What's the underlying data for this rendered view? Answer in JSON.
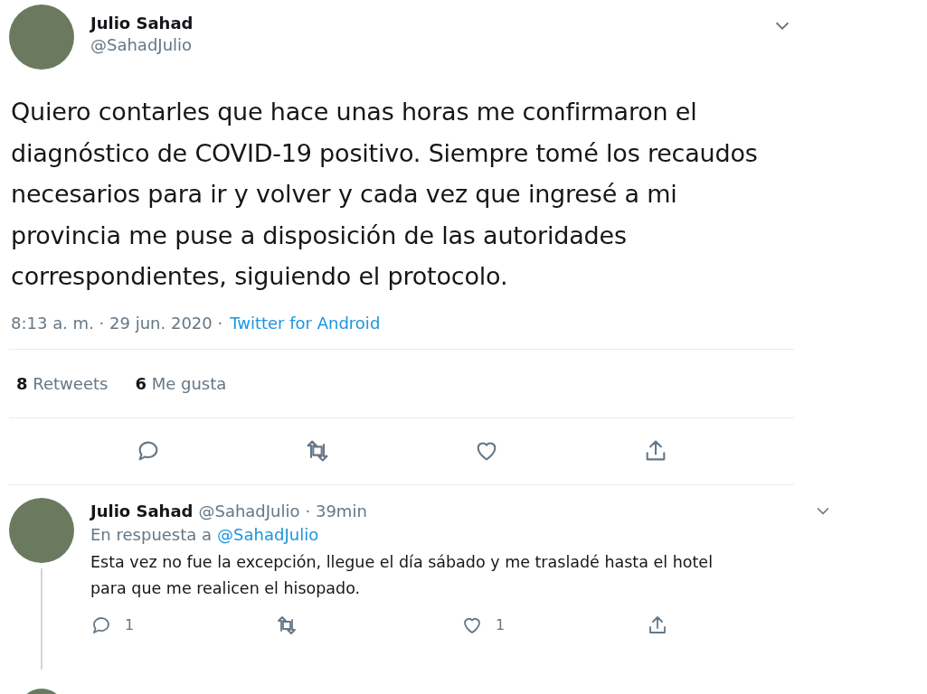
{
  "tweet": {
    "name": "Julio Sahad",
    "handle": "@SahadJulio",
    "text": "Quiero contarles que hace unas horas me confirmaron el diagnóstico de COVID-19 positivo. Siempre tomé los recaudos necesarios para ir y volver y cada vez que ingresé a mi provincia me puse a disposición de las autoridades correspondientes, siguiendo el protocolo.",
    "timestamp": "8:13 a. m. · 29 jun. 2020 ·",
    "source": "Twitter for Android",
    "stats": [
      {
        "count": "8",
        "label": "Retweets"
      },
      {
        "count": "6",
        "label": "Me gusta"
      }
    ]
  },
  "reply": {
    "name": "Julio Sahad",
    "handle": "@SahadJulio",
    "time": "· 39min",
    "in_reply_prefix": "En respuesta a",
    "in_reply_handle": "@SahadJulio",
    "text": "Esta vez no fue la excepción, llegue el día sábado y me trasladé hasta el hotel para que me realicen el hisopado.",
    "actions": [
      {
        "kind": "reply",
        "count": "1"
      },
      {
        "kind": "retweet"
      },
      {
        "kind": "like",
        "count": "1"
      },
      {
        "kind": "share"
      }
    ]
  },
  "main_actions": [
    {
      "kind": "reply"
    },
    {
      "kind": "retweet"
    },
    {
      "kind": "like"
    },
    {
      "kind": "share"
    }
  ]
}
